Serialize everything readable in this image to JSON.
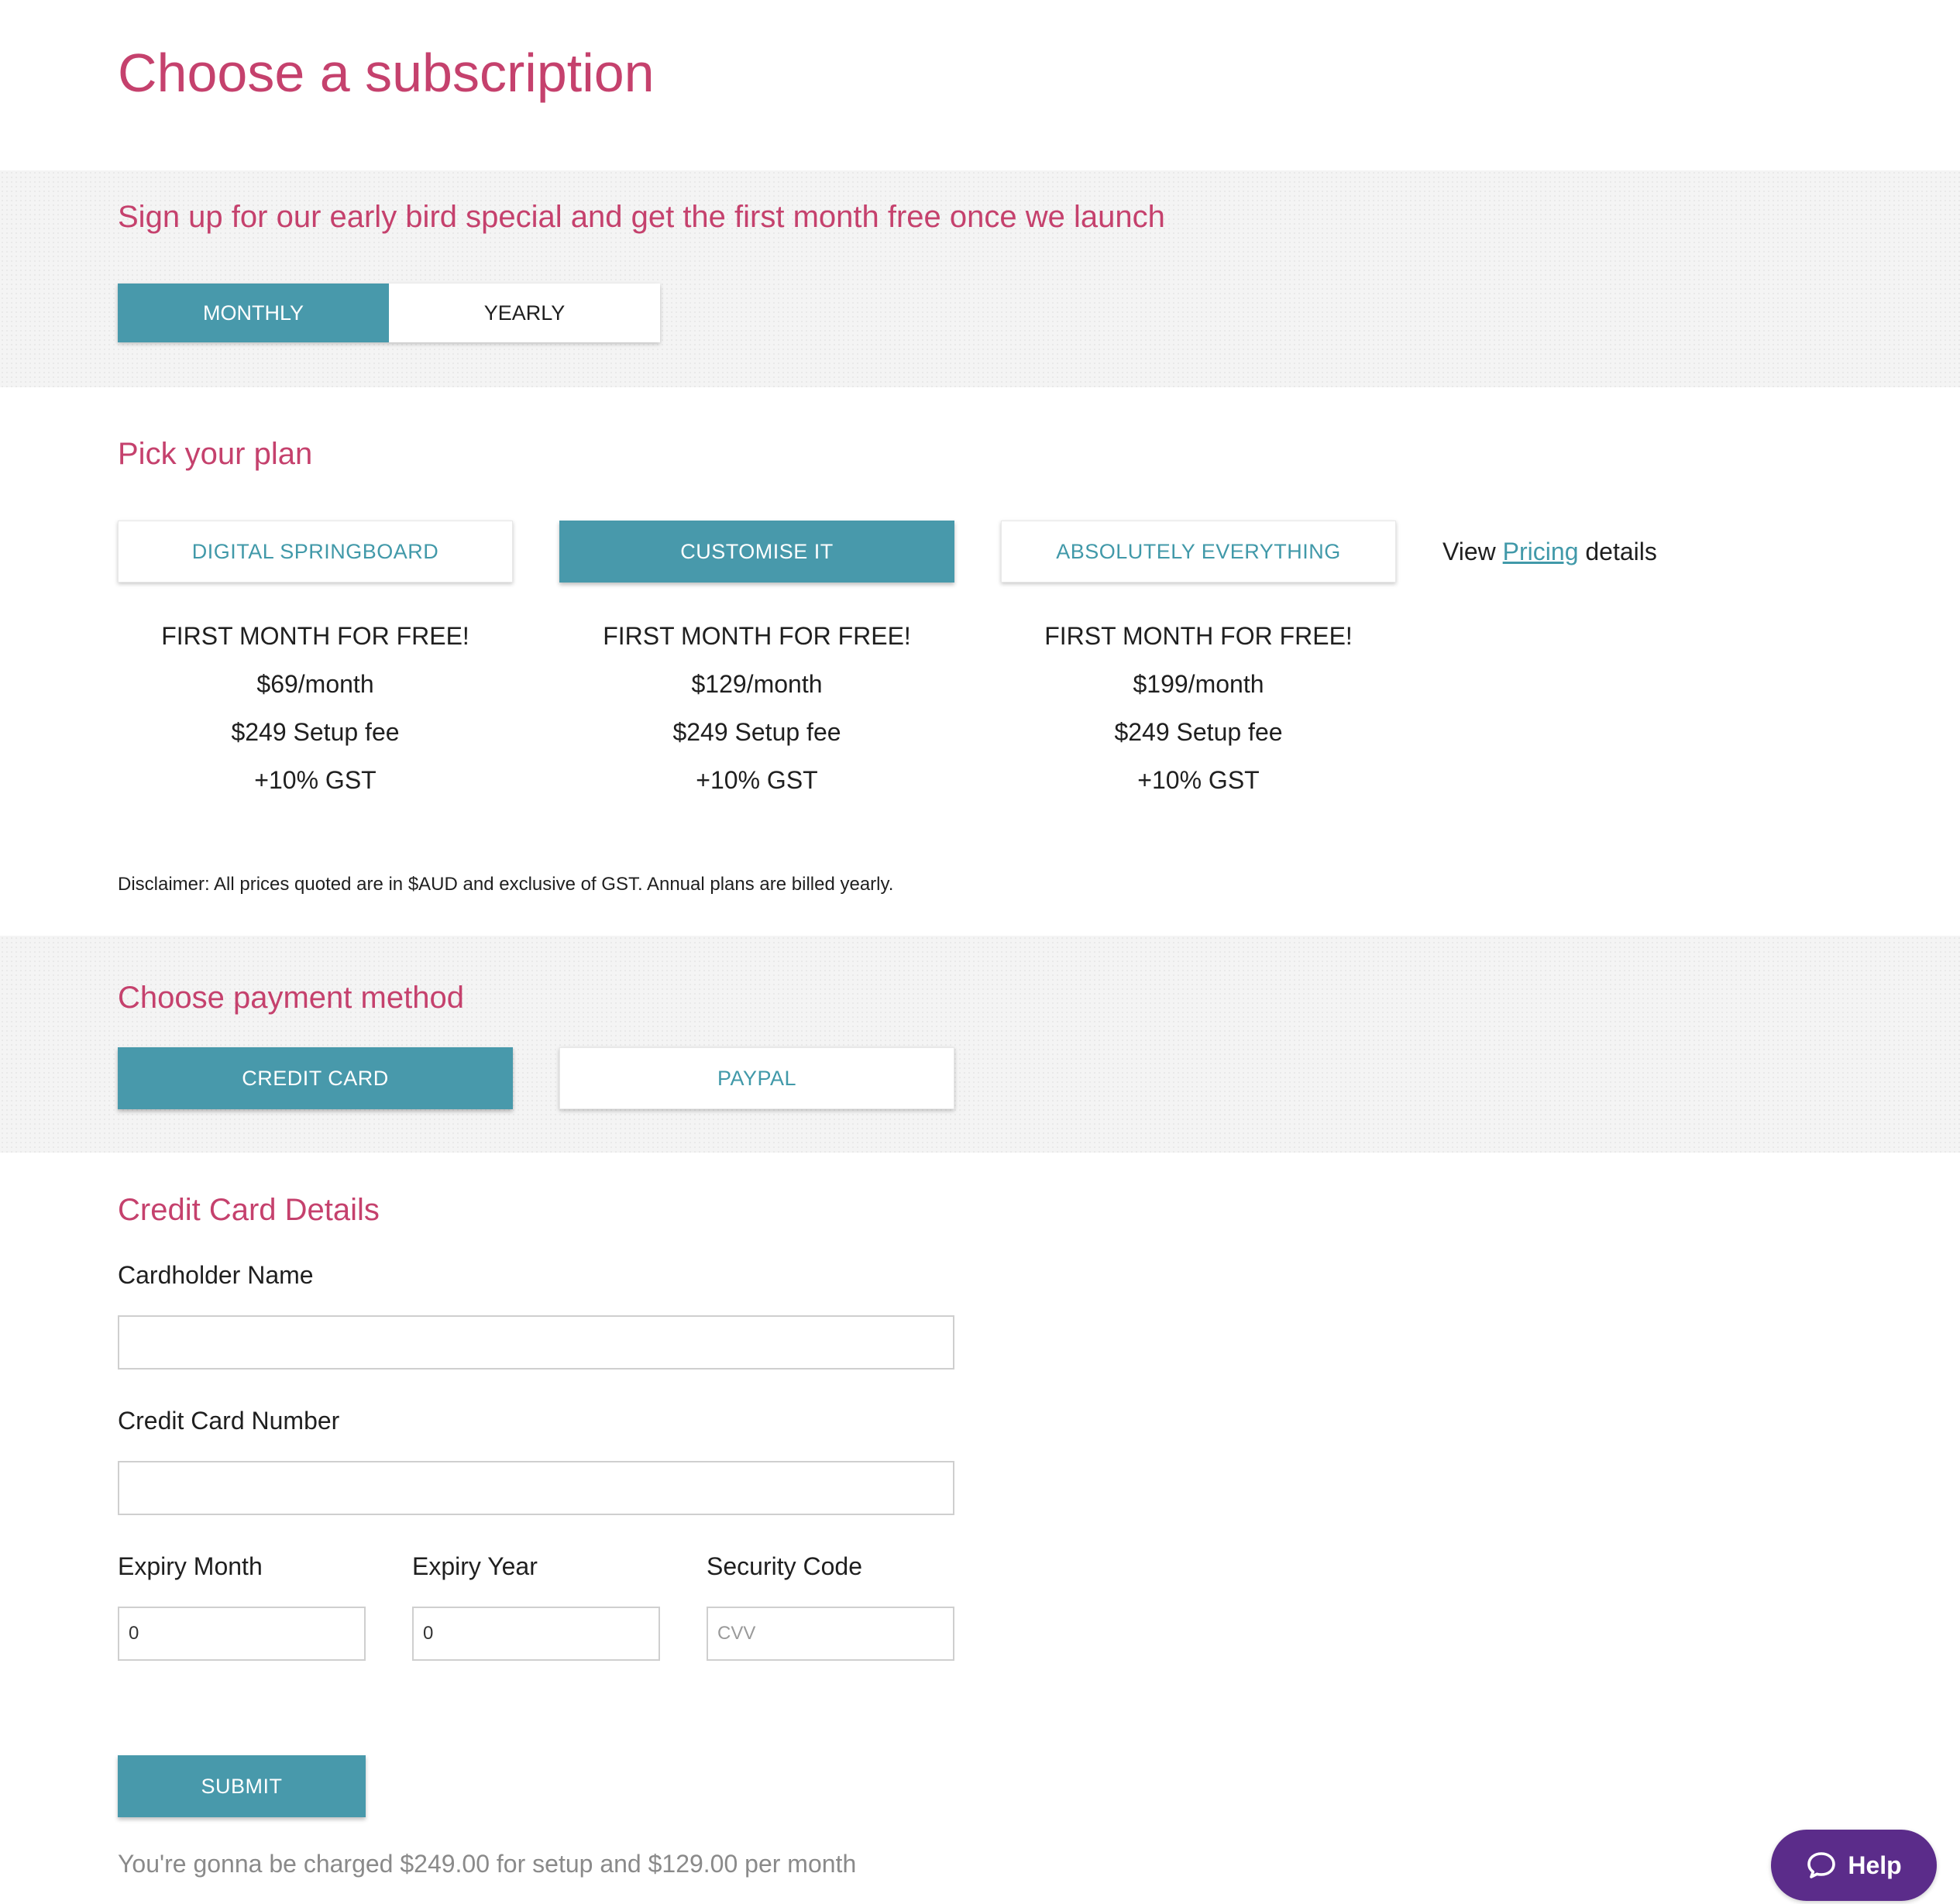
{
  "page_title": "Choose a subscription",
  "promo": {
    "headline": "Sign up for our early bird special and get the first month free once we launch",
    "billing_toggle": {
      "options": [
        "MONTHLY",
        "YEARLY"
      ],
      "selected": "MONTHLY"
    }
  },
  "plans_section": {
    "title": "Pick your plan",
    "plans": [
      {
        "name": "DIGITAL SPRINGBOARD",
        "selected": false,
        "promo": "FIRST MONTH FOR FREE!",
        "price": "$69/month",
        "setup": "$249 Setup fee",
        "gst": "+10% GST"
      },
      {
        "name": "CUSTOMISE IT",
        "selected": true,
        "promo": "FIRST MONTH FOR FREE!",
        "price": "$129/month",
        "setup": "$249 Setup fee",
        "gst": "+10% GST"
      },
      {
        "name": "ABSOLUTELY EVERYTHING",
        "selected": false,
        "promo": "FIRST MONTH FOR FREE!",
        "price": "$199/month",
        "setup": "$249 Setup fee",
        "gst": "+10% GST"
      }
    ],
    "pricing_link": {
      "prefix": "View",
      "link_text": "Pricing",
      "suffix": "details"
    },
    "disclaimer": "Disclaimer: All prices quoted are in $AUD and exclusive of GST. Annual plans are billed yearly."
  },
  "payment_section": {
    "title": "Choose payment method",
    "methods": [
      "CREDIT CARD",
      "PAYPAL"
    ],
    "selected": "CREDIT CARD"
  },
  "card_form": {
    "title": "Credit Card Details",
    "cardholder_label": "Cardholder Name",
    "cardholder_value": "",
    "card_number_label": "Credit Card Number",
    "card_number_value": "",
    "expiry_month_label": "Expiry Month",
    "expiry_month_value": "0",
    "expiry_year_label": "Expiry Year",
    "expiry_year_value": "0",
    "security_code_label": "Security Code",
    "security_code_placeholder": "CVV",
    "submit_label": "SUBMIT",
    "charge_note": "You're gonna be charged $249.00 for setup and $129.00 per month"
  },
  "help_widget": {
    "label": "Help",
    "icon": "chat-bubble-icon"
  },
  "colors": {
    "accent": "#4899ab",
    "heading": "#c5416d",
    "help": "#5b2c8a"
  }
}
